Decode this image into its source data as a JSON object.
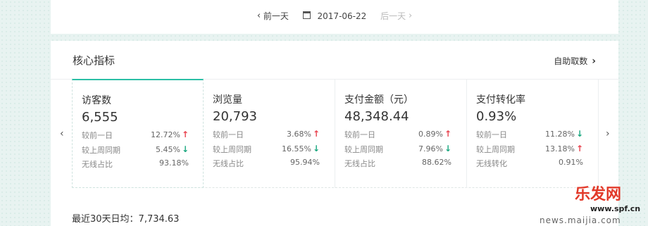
{
  "date_nav": {
    "prev_label": "前一天",
    "date": "2017-06-22",
    "next_label": "后一天"
  },
  "header": {
    "title": "核心指标",
    "self_service_label": "自助取数"
  },
  "metrics": [
    {
      "name": "访客数",
      "value": "6,555",
      "rows": [
        {
          "label": "较前一日",
          "value": "12.72%",
          "trend": "up"
        },
        {
          "label": "较上周同期",
          "value": "5.45%",
          "trend": "down"
        },
        {
          "label": "无线占比",
          "value": "93.18%",
          "trend": "none"
        }
      ]
    },
    {
      "name": "浏览量",
      "value": "20,793",
      "rows": [
        {
          "label": "较前一日",
          "value": "3.68%",
          "trend": "up"
        },
        {
          "label": "较上周同期",
          "value": "16.55%",
          "trend": "down"
        },
        {
          "label": "无线占比",
          "value": "95.94%",
          "trend": "none"
        }
      ]
    },
    {
      "name": "支付金额（元）",
      "value": "48,348.44",
      "rows": [
        {
          "label": "较前一日",
          "value": "0.89%",
          "trend": "up"
        },
        {
          "label": "较上周同期",
          "value": "7.96%",
          "trend": "down"
        },
        {
          "label": "无线占比",
          "value": "88.62%",
          "trend": "none"
        }
      ]
    },
    {
      "name": "支付转化率",
      "value": "0.93%",
      "rows": [
        {
          "label": "较前一日",
          "value": "11.28%",
          "trend": "down"
        },
        {
          "label": "较上周同期",
          "value": "13.18%",
          "trend": "up"
        },
        {
          "label": "无线转化",
          "value": "0.91%",
          "trend": "none"
        }
      ]
    }
  ],
  "summary": {
    "avg_label": "最近30天日均：7,734.63"
  },
  "watermark": {
    "brand": "乐发网",
    "site": "www.spf.cn",
    "url": "news.maijia.com"
  },
  "colors": {
    "accent": "#2bbfa6",
    "up": "#e8434f",
    "down": "#1aa77f"
  },
  "icons": {
    "up": "arrow-up-icon",
    "down": "arrow-down-icon"
  }
}
